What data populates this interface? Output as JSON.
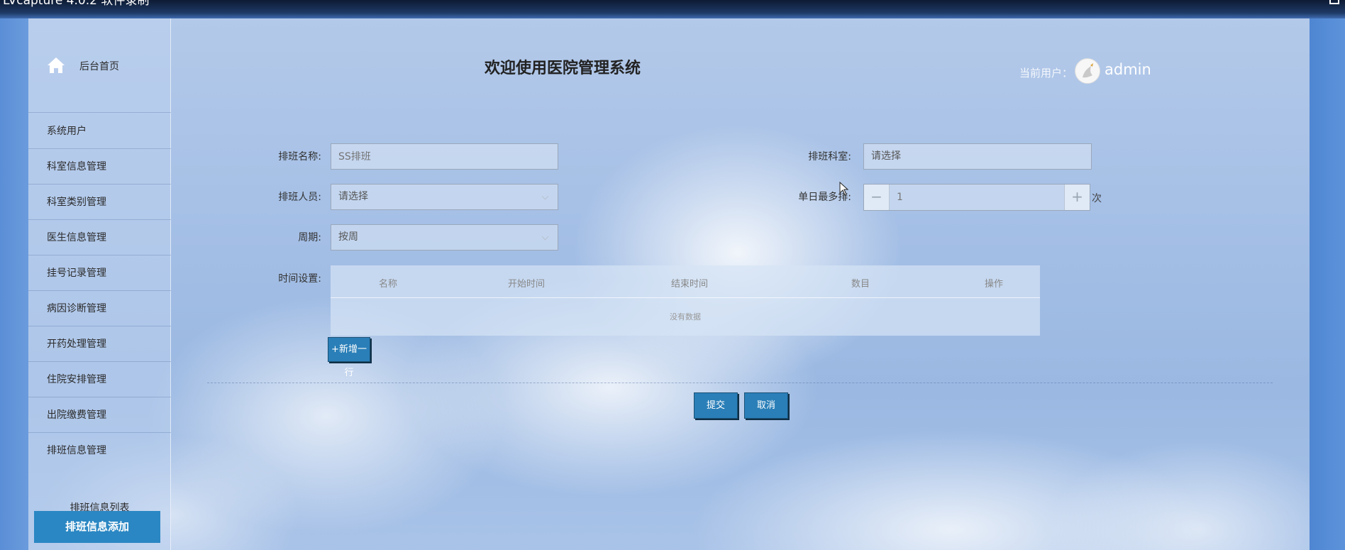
{
  "window": {
    "title": "LVcapture 4.0.2 软件录制"
  },
  "sidebar": {
    "home_label": "后台首页",
    "items": [
      {
        "label": "系统用户"
      },
      {
        "label": "科室信息管理"
      },
      {
        "label": "科室类别管理"
      },
      {
        "label": "医生信息管理"
      },
      {
        "label": "挂号记录管理"
      },
      {
        "label": "病因诊断管理"
      },
      {
        "label": "开药处理管理"
      },
      {
        "label": "住院安排管理"
      },
      {
        "label": "出院缴费管理"
      },
      {
        "label": "排班信息管理"
      }
    ],
    "sub_item": "排班信息列表",
    "active_item": "排班信息添加"
  },
  "header": {
    "title": "欢迎使用医院管理系统",
    "user_label": "当前用户：",
    "user_name": "admin"
  },
  "form": {
    "name_label": "排班名称:",
    "name_placeholder": "SS排班",
    "dept_label": "排班科室:",
    "dept_value": "请选择",
    "staff_label": "排班人员:",
    "staff_value": "请选择",
    "max_label": "单日最多排:",
    "max_value": "1",
    "max_unit": "次",
    "minus": "−",
    "plus": "+",
    "cycle_label": "周期:",
    "cycle_value": "按周",
    "time_label": "时间设置:"
  },
  "time_table": {
    "columns": [
      "名称",
      "开始时间",
      "结束时间",
      "数目",
      "操作"
    ],
    "empty_text": "没有数据"
  },
  "buttons": {
    "add_row": "+新增一行",
    "submit": "提交",
    "cancel": "取消"
  },
  "colors": {
    "accent": "#2a87c3",
    "button": "#2a7fb8"
  }
}
